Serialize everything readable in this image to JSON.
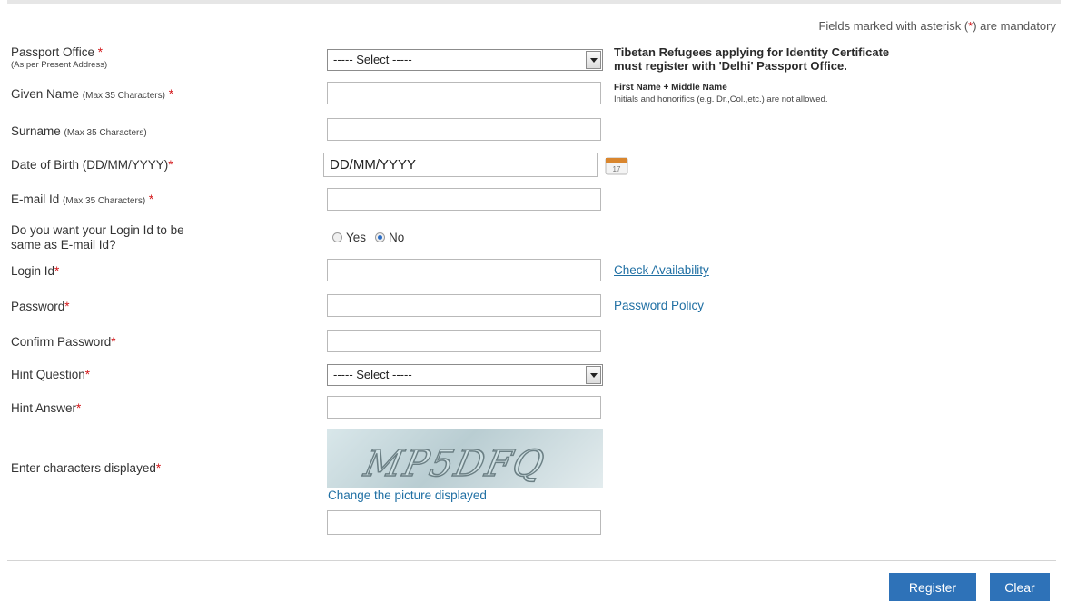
{
  "mandatory_note": {
    "prefix": "Fields marked with asterisk (",
    "star": "*",
    "suffix": ") are mandatory"
  },
  "required_marker": "*",
  "fields": {
    "passport_office": {
      "label": "Passport Office ",
      "sub": "(As per Present Address)",
      "select_value": "----- Select -----"
    },
    "given_name": {
      "label": "Given Name ",
      "hint": "(Max 35 Characters)",
      "value": ""
    },
    "surname": {
      "label": "Surname ",
      "hint": "(Max 35 Characters)",
      "value": ""
    },
    "dob": {
      "label": "Date of Birth (DD/MM/YYYY)",
      "value": "DD/MM/YYYY",
      "calendar_icon": "calendar-icon",
      "calendar_text": "17"
    },
    "email": {
      "label": "E-mail Id ",
      "hint": "(Max 35 Characters)",
      "value": ""
    },
    "login_same": {
      "label_line1": "Do you want your Login Id to be",
      "label_line2": "same as E-mail Id?",
      "options": [
        "Yes",
        "No"
      ],
      "selected": "No"
    },
    "login_id": {
      "label": "Login Id",
      "value": ""
    },
    "password": {
      "label": "Password",
      "value": ""
    },
    "confirm_password": {
      "label": "Confirm Password",
      "value": ""
    },
    "hint_question": {
      "label": "Hint Question",
      "select_value": "----- Select -----"
    },
    "hint_answer": {
      "label": "Hint Answer",
      "value": ""
    },
    "captcha": {
      "label": "Enter characters displayed",
      "image_text": "MP5DFQ",
      "change_link": "Change the picture displayed",
      "value": ""
    }
  },
  "notes": {
    "tibetan_line1": "Tibetan Refugees applying for Identity Certificate",
    "tibetan_line2": "must register with 'Delhi' Passport Office.",
    "name_title": "First Name + Middle Name",
    "name_detail": "Initials and honorifics (e.g. Dr.,Col.,etc.) are not allowed."
  },
  "links": {
    "check_availability": "Check Availability",
    "password_policy": "Password Policy"
  },
  "buttons": {
    "register": "Register",
    "clear": "Clear"
  },
  "colors": {
    "accent": "#2e72b8",
    "link": "#1f6fa3",
    "required": "#d3171a"
  }
}
